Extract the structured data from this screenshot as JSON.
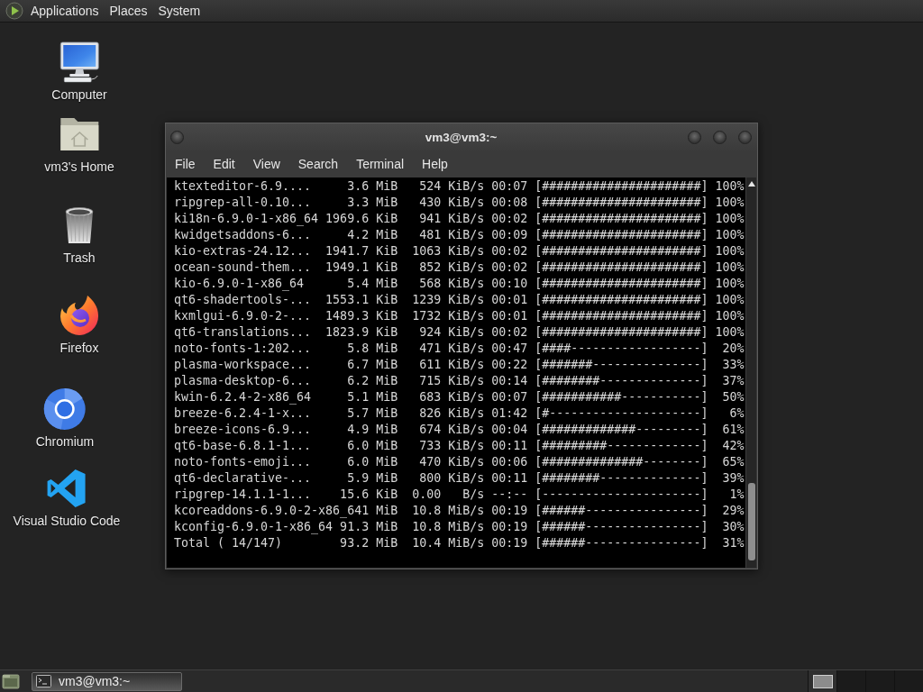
{
  "top_panel": {
    "menus": [
      "Applications",
      "Places",
      "System"
    ]
  },
  "desktop_icons": [
    {
      "kind": "computer",
      "label": "Computer"
    },
    {
      "kind": "home",
      "label": "vm3's Home"
    },
    {
      "kind": "trash",
      "label": "Trash"
    },
    {
      "kind": "firefox",
      "label": "Firefox"
    },
    {
      "kind": "chromium",
      "label": "Chromium"
    },
    {
      "kind": "vscode",
      "label": "Visual Studio Code"
    }
  ],
  "terminal_window": {
    "title": "vm3@vm3:~",
    "menu": [
      "File",
      "Edit",
      "View",
      "Search",
      "Terminal",
      "Help"
    ],
    "lines": [
      "ktexteditor-6.9....     3.6 MiB   524 KiB/s 00:07 [######################] 100%",
      "ripgrep-all-0.10...     3.3 MiB   430 KiB/s 00:08 [######################] 100%",
      "ki18n-6.9.0-1-x86_64 1969.6 KiB   941 KiB/s 00:02 [######################] 100%",
      "kwidgetsaddons-6...     4.2 MiB   481 KiB/s 00:09 [######################] 100%",
      "kio-extras-24.12...  1941.7 KiB  1063 KiB/s 00:02 [######################] 100%",
      "ocean-sound-them...  1949.1 KiB   852 KiB/s 00:02 [######################] 100%",
      "kio-6.9.0-1-x86_64      5.4 MiB   568 KiB/s 00:10 [######################] 100%",
      "qt6-shadertools-...  1553.1 KiB  1239 KiB/s 00:01 [######################] 100%",
      "kxmlgui-6.9.0-2-...  1489.3 KiB  1732 KiB/s 00:01 [######################] 100%",
      "qt6-translations...  1823.9 KiB   924 KiB/s 00:02 [######################] 100%",
      "noto-fonts-1:202...     5.8 MiB   471 KiB/s 00:47 [####------------------]  20%",
      "plasma-workspace...     6.7 MiB   611 KiB/s 00:22 [#######---------------]  33%",
      "plasma-desktop-6...     6.2 MiB   715 KiB/s 00:14 [########--------------]  37%",
      "kwin-6.2.4-2-x86_64     5.1 MiB   683 KiB/s 00:07 [###########-----------]  50%",
      "breeze-6.2.4-1-x...     5.7 MiB   826 KiB/s 01:42 [#---------------------]   6%",
      "breeze-icons-6.9...     4.9 MiB   674 KiB/s 00:04 [#############---------]  61%",
      "qt6-base-6.8.1-1...     6.0 MiB   733 KiB/s 00:11 [#########-------------]  42%",
      "noto-fonts-emoji...     6.0 MiB   470 KiB/s 00:06 [##############--------]  65%",
      "qt6-declarative-...     5.9 MiB   800 KiB/s 00:11 [########--------------]  39%",
      "ripgrep-14.1.1-1...    15.6 KiB  0.00   B/s --:-- [----------------------]   1%",
      "kcoreaddons-6.9.0-2-x86_641 MiB  10.8 MiB/s 00:19 [######----------------]  29%",
      "kconfig-6.9.0-1-x86_64 91.3 MiB  10.8 MiB/s 00:19 [######----------------]  30%",
      "Total ( 14/147)        93.2 MiB  10.4 MiB/s 00:19 [######----------------]  31%"
    ]
  },
  "taskbar": {
    "tasks": [
      {
        "label": "vm3@vm3:~",
        "selected": true
      }
    ],
    "workspaces": [
      {
        "selected": true
      },
      {
        "selected": false
      },
      {
        "selected": false
      },
      {
        "selected": false
      }
    ]
  }
}
